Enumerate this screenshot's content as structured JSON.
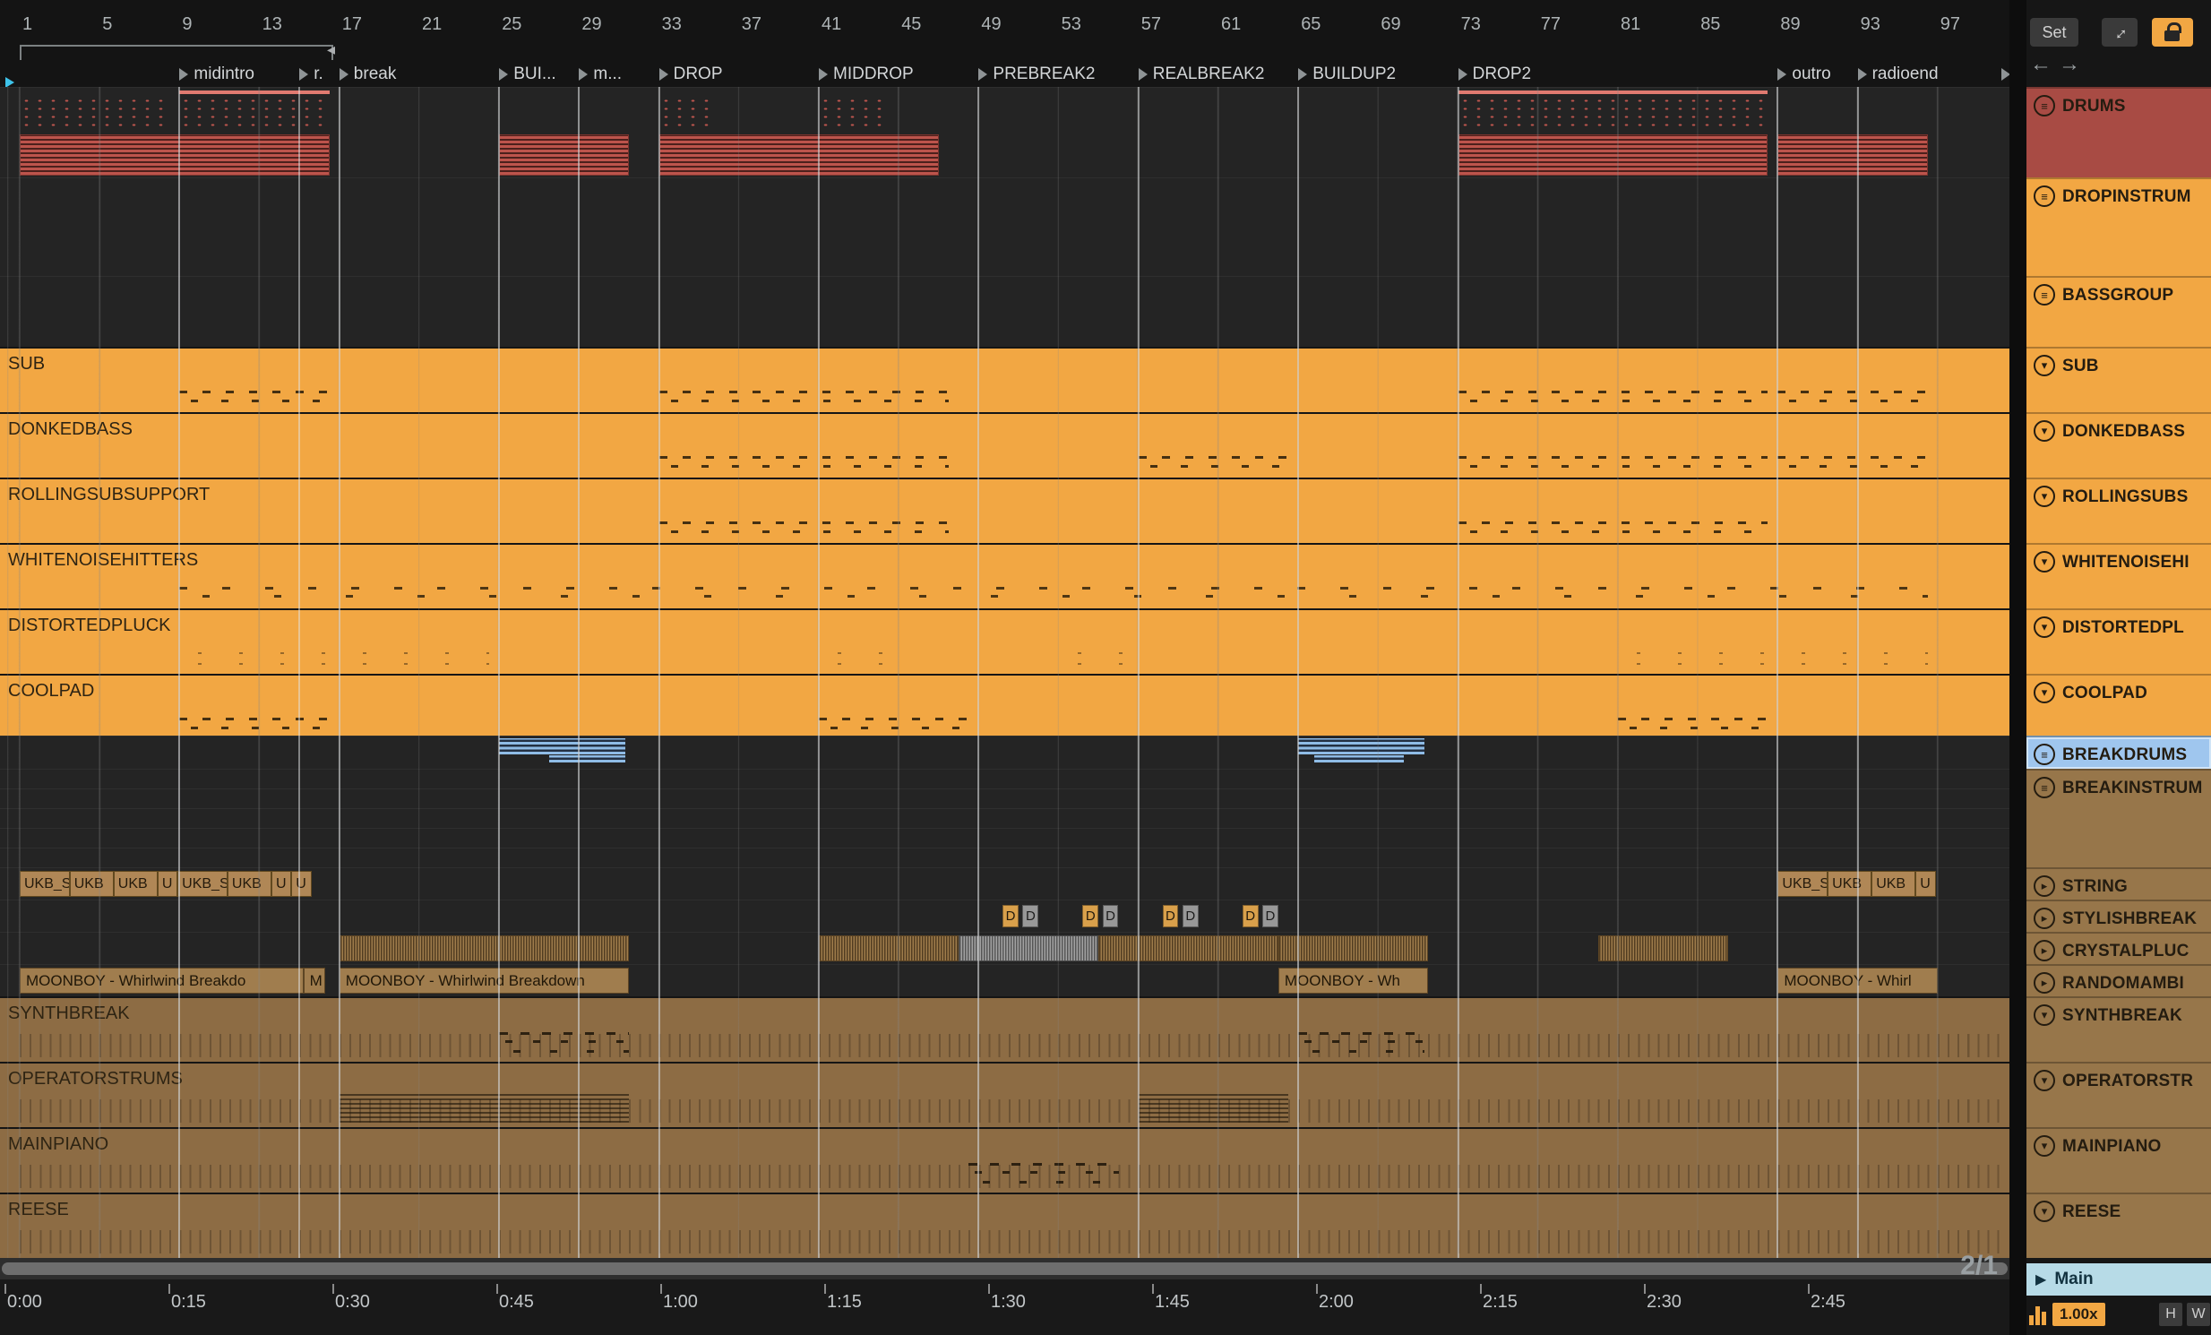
{
  "icons": {
    "menu": "≡",
    "fold": "▾",
    "play": "▸",
    "main_play": "▶",
    "back": "←",
    "forward": "→",
    "expand": "↔",
    "loop_arrow": "◂"
  },
  "topbar": {
    "set_label": "Set"
  },
  "bottom": {
    "position": "2/1",
    "zoom": "1.00x",
    "h": "H",
    "w": "W"
  },
  "sidebar_main": {
    "label": "Main"
  },
  "rulers": {
    "bar_labels": [
      "1",
      "5",
      "9",
      "13",
      "17",
      "21",
      "25",
      "29",
      "33",
      "37",
      "41",
      "45",
      "49",
      "53",
      "57",
      "61",
      "65",
      "69",
      "73",
      "77",
      "81",
      "85",
      "89",
      "93",
      "97"
    ],
    "time_labels": [
      "0:00",
      "0:15",
      "0:30",
      "0:45",
      "1:00",
      "1:15",
      "1:30",
      "1:45",
      "2:00",
      "2:15",
      "2:30",
      "2:45"
    ]
  },
  "loop": {
    "start_bar": 1,
    "end_bar": 16.5
  },
  "locators": [
    {
      "label": "midintro",
      "bar": 9
    },
    {
      "label": "r.",
      "bar": 15
    },
    {
      "label": "break",
      "bar": 17
    },
    {
      "label": "BUI...",
      "bar": 25
    },
    {
      "label": "m...",
      "bar": 29
    },
    {
      "label": "DROP",
      "bar": 33
    },
    {
      "label": "MIDDROP",
      "bar": 41
    },
    {
      "label": "PREBREAK2",
      "bar": 49
    },
    {
      "label": "REALBREAK2",
      "bar": 57
    },
    {
      "label": "BUILDUP2",
      "bar": 65
    },
    {
      "label": "DROP2",
      "bar": 73
    },
    {
      "label": "outro",
      "bar": 89
    },
    {
      "label": "radioend",
      "bar": 93
    },
    {
      "label": "",
      "bar": 100.2
    }
  ],
  "tracks": [
    {
      "id": "drums",
      "sidebar": "DRUMS",
      "icon": "menu",
      "color": "red",
      "bg": "dark",
      "h": 101,
      "label": null,
      "clips": [
        {
          "t": "red-line",
          "a": 9,
          "b": 16.5
        },
        {
          "t": "red-line",
          "a": 73,
          "b": 88.5
        },
        {
          "t": "red-sparse",
          "a": 1,
          "b": 8.5
        },
        {
          "t": "red-sparse",
          "a": 9,
          "b": 16.5
        },
        {
          "t": "red-sparse",
          "a": 33,
          "b": 35.5
        },
        {
          "t": "red-sparse",
          "a": 41,
          "b": 44.5
        },
        {
          "t": "red-sparse",
          "a": 73,
          "b": 88.5
        },
        {
          "t": "red-dense",
          "a": 1,
          "b": 16.5
        },
        {
          "t": "red-dense",
          "a": 25,
          "b": 31.5
        },
        {
          "t": "red-dense",
          "a": 33,
          "b": 47
        },
        {
          "t": "red-dense",
          "a": 73,
          "b": 88.5
        },
        {
          "t": "red-dense",
          "a": 89,
          "b": 96.5
        }
      ]
    },
    {
      "id": "dropinstrum",
      "sidebar": "DROPINSTRUM",
      "icon": "menu",
      "color": "orange",
      "bg": "dark",
      "h": 110,
      "label": null,
      "clips": []
    },
    {
      "id": "bassgroup",
      "sidebar": "BASSGROUP",
      "icon": "menu",
      "color": "orange",
      "bg": "dark",
      "h": 79,
      "label": null,
      "clips": []
    },
    {
      "id": "sub",
      "sidebar": "SUB",
      "icon": "fold",
      "color": "orange",
      "bg": "orange",
      "h": 73,
      "label": "SUB",
      "clips": [
        {
          "t": "marks",
          "a": 9,
          "b": 16.5
        },
        {
          "t": "marks",
          "a": 33,
          "b": 47.5
        },
        {
          "t": "marks",
          "a": 73,
          "b": 88.5
        },
        {
          "t": "marks",
          "a": 89,
          "b": 96.5
        }
      ]
    },
    {
      "id": "donkedbass",
      "sidebar": "DONKEDBASS",
      "icon": "fold",
      "color": "orange",
      "bg": "orange",
      "h": 73,
      "label": "DONKEDBASS",
      "clips": [
        {
          "t": "marks",
          "a": 33,
          "b": 47.5
        },
        {
          "t": "marks",
          "a": 57,
          "b": 64.5
        },
        {
          "t": "marks",
          "a": 73,
          "b": 88.5
        },
        {
          "t": "marks",
          "a": 89,
          "b": 96.5
        }
      ]
    },
    {
      "id": "rollingsubs",
      "sidebar": "ROLLINGSUBS",
      "icon": "fold",
      "color": "orange",
      "bg": "orange",
      "h": 73,
      "label": "ROLLINGSUBSUPPORT",
      "clips": [
        {
          "t": "marks",
          "a": 33,
          "b": 47.5
        },
        {
          "t": "marks",
          "a": 73,
          "b": 88.5
        }
      ]
    },
    {
      "id": "whitenoisehitters",
      "sidebar": "WHITENOISEHI",
      "icon": "fold",
      "color": "orange",
      "bg": "orange",
      "h": 73,
      "label": "WHITENOISEHITTERS",
      "clips": [
        {
          "t": "marks-sparse",
          "a": 9,
          "b": 96.5
        }
      ]
    },
    {
      "id": "distortedpluck",
      "sidebar": "DISTORTEDPL",
      "icon": "fold",
      "color": "orange",
      "bg": "orange",
      "h": 73,
      "label": "DISTORTEDPLUCK",
      "clips": [
        {
          "t": "dots",
          "a": 9,
          "b": 24.5
        },
        {
          "t": "dots",
          "a": 41,
          "b": 45
        },
        {
          "t": "dots",
          "a": 53,
          "b": 56.5
        },
        {
          "t": "dots",
          "a": 81,
          "b": 96.5
        }
      ]
    },
    {
      "id": "coolpad",
      "sidebar": "COOLPAD",
      "icon": "fold",
      "color": "orange",
      "bg": "orange",
      "h": 69,
      "label": "COOLPAD",
      "clips": [
        {
          "t": "marks",
          "a": 9,
          "b": 16.5
        },
        {
          "t": "marks",
          "a": 41,
          "b": 48.5
        },
        {
          "t": "marks",
          "a": 81,
          "b": 88.5
        }
      ]
    },
    {
      "id": "breakdrums",
      "sidebar": "BREAKDRUMS",
      "icon": "menu",
      "color": "blue",
      "bg": "dark",
      "h": 37,
      "label": null,
      "selected": true,
      "clips": [
        {
          "t": "blue",
          "a": 25,
          "b": 31.3
        },
        {
          "t": "blue-tail",
          "a": 27.5,
          "b": 31.3
        },
        {
          "t": "blue",
          "a": 65,
          "b": 71.3
        },
        {
          "t": "blue-tail",
          "a": 65.8,
          "b": 70.3
        }
      ]
    },
    {
      "id": "breakinstrum",
      "sidebar": "BREAKINSTRUM",
      "icon": "menu",
      "color": "brown",
      "bg": "dark",
      "h": 110,
      "rows": true,
      "label": null,
      "clips": []
    },
    {
      "id": "string",
      "sidebar": "STRING",
      "icon": "play",
      "color": "brown",
      "bg": "dark",
      "h": 36,
      "label": null,
      "clips": [
        {
          "t": "ukb",
          "a": 1,
          "b": 3.5,
          "text": "UKB_S"
        },
        {
          "t": "ukb",
          "a": 3.5,
          "b": 5.7,
          "text": "UKB"
        },
        {
          "t": "ukb",
          "a": 5.7,
          "b": 7.9,
          "text": "UKB"
        },
        {
          "t": "ukb",
          "a": 7.9,
          "b": 8.9,
          "text": "U"
        },
        {
          "t": "ukb",
          "a": 8.9,
          "b": 11.4,
          "text": "UKB_S"
        },
        {
          "t": "ukb",
          "a": 11.4,
          "b": 13.6,
          "text": "UKB"
        },
        {
          "t": "ukb",
          "a": 13.6,
          "b": 14.6,
          "text": "U"
        },
        {
          "t": "ukb",
          "a": 14.6,
          "b": 15.6,
          "text": "U"
        },
        {
          "t": "ukb",
          "a": 89,
          "b": 91.5,
          "text": "UKB_S"
        },
        {
          "t": "ukb",
          "a": 91.5,
          "b": 93.7,
          "text": "UKB"
        },
        {
          "t": "ukb",
          "a": 93.7,
          "b": 95.9,
          "text": "UKB"
        },
        {
          "t": "ukb",
          "a": 95.9,
          "b": 96.9,
          "text": "U"
        }
      ]
    },
    {
      "id": "stylishbreak",
      "sidebar": "STYLISHBREAK",
      "icon": "play",
      "color": "brown",
      "bg": "dark",
      "h": 36,
      "label": null,
      "clips": [
        {
          "t": "d-tan",
          "a": 50.2,
          "b": 51,
          "text": "D"
        },
        {
          "t": "d-gray",
          "a": 51.2,
          "b": 52,
          "text": "D"
        },
        {
          "t": "d-tan",
          "a": 54.2,
          "b": 55,
          "text": "D"
        },
        {
          "t": "d-gray",
          "a": 55.2,
          "b": 56,
          "text": "D"
        },
        {
          "t": "d-tan",
          "a": 58.2,
          "b": 59,
          "text": "D"
        },
        {
          "t": "d-gray",
          "a": 59.2,
          "b": 60,
          "text": "D"
        },
        {
          "t": "d-tan",
          "a": 62.2,
          "b": 63,
          "text": "D"
        },
        {
          "t": "d-gray",
          "a": 63.2,
          "b": 64,
          "text": "D"
        }
      ]
    },
    {
      "id": "crystalpluc",
      "sidebar": "CRYSTALPLUC",
      "icon": "play",
      "color": "brown",
      "bg": "dark",
      "h": 36,
      "label": null,
      "clips": [
        {
          "t": "wave",
          "a": 17,
          "b": 31.5
        },
        {
          "t": "wave",
          "a": 41,
          "b": 48
        },
        {
          "t": "wave-gray",
          "a": 48,
          "b": 55
        },
        {
          "t": "wave",
          "a": 55,
          "b": 64
        },
        {
          "t": "wave",
          "a": 64,
          "b": 71.5
        },
        {
          "t": "wave",
          "a": 80,
          "b": 86.5
        }
      ]
    },
    {
      "id": "randomambi",
      "sidebar": "RANDOMAMBI",
      "icon": "play",
      "color": "brown",
      "bg": "dark",
      "h": 36,
      "label": null,
      "clips": [
        {
          "t": "mlabel",
          "a": 1,
          "b": 15.2,
          "text": "MOONBOY - Whirlwind Breakdo"
        },
        {
          "t": "mlabel",
          "a": 15.2,
          "b": 16.3,
          "text": "M"
        },
        {
          "t": "mlabel",
          "a": 17,
          "b": 31.5,
          "text": "MOONBOY - Whirlwind Breakdown"
        },
        {
          "t": "mlabel",
          "a": 64,
          "b": 71.5,
          "text": "MOONBOY - Wh"
        },
        {
          "t": "mlabel",
          "a": 89,
          "b": 97,
          "text": "MOONBOY - Whirl"
        }
      ]
    },
    {
      "id": "synthbreak",
      "sidebar": "SYNTHBREAK",
      "icon": "fold",
      "color": "brown",
      "bg": "brown",
      "h": 73,
      "label": "SYNTHBREAK",
      "ticks": true,
      "clips": [
        {
          "t": "notes",
          "a": 25,
          "b": 31.5
        },
        {
          "t": "notes",
          "a": 65,
          "b": 71.3
        }
      ]
    },
    {
      "id": "operatorstrums",
      "sidebar": "OPERATORSTR",
      "icon": "fold",
      "color": "brown",
      "bg": "brown",
      "h": 73,
      "label": "OPERATORSTRUMS",
      "ticks": true,
      "clips": [
        {
          "t": "hstr",
          "a": 17,
          "b": 31.5
        },
        {
          "t": "hstr",
          "a": 57,
          "b": 64.5
        }
      ]
    },
    {
      "id": "mainpiano",
      "sidebar": "MAINPIANO",
      "icon": "fold",
      "color": "brown",
      "bg": "brown",
      "h": 73,
      "label": "MAINPIANO",
      "ticks": true,
      "clips": [
        {
          "t": "notes",
          "a": 48.5,
          "b": 56
        }
      ]
    },
    {
      "id": "reese",
      "sidebar": "REESE",
      "icon": "fold",
      "color": "brown",
      "bg": "brown",
      "h": 73,
      "label": "REESE",
      "ticks": true,
      "clips": []
    }
  ]
}
